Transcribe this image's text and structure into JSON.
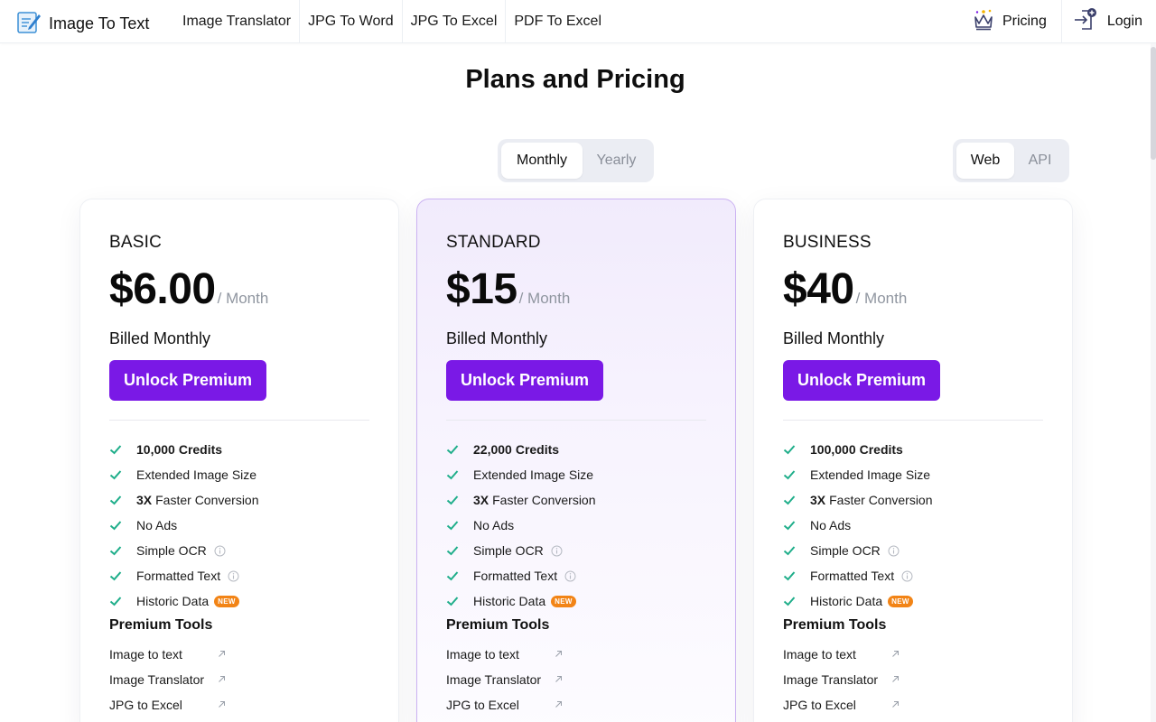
{
  "header": {
    "logo_text": "Image To Text",
    "nav": [
      {
        "label": "Image Translator"
      },
      {
        "label": "JPG To Word"
      },
      {
        "label": "JPG To Excel"
      },
      {
        "label": "PDF To Excel"
      }
    ],
    "pricing_label": "Pricing",
    "login_label": "Login"
  },
  "page_title": "Plans and Pricing",
  "billing_toggle": {
    "options": [
      "Monthly",
      "Yearly"
    ],
    "selected": "Monthly"
  },
  "channel_toggle": {
    "options": [
      "Web",
      "API"
    ],
    "selected": "Web"
  },
  "colors": {
    "accent": "#7a19e6",
    "check": "#1fae8a",
    "badge": "#f28416",
    "highlight_border": "#cbb2f2"
  },
  "plans": [
    {
      "name": "BASIC",
      "price": "$6.00",
      "per": "/ Month",
      "billed": "Billed Monthly",
      "cta": "Unlock Premium",
      "features": {
        "credits": {
          "value": "10,000",
          "label": "Credits"
        },
        "image_size": "Extended Image Size",
        "faster": {
          "value": "3X",
          "label": "Faster Conversion"
        },
        "no_ads": "No Ads",
        "simple_ocr": "Simple OCR",
        "formatted_text": "Formatted Text",
        "historic_data": "Historic Data",
        "new_badge": "NEW"
      },
      "tools_title": "Premium Tools",
      "tools": [
        "Image to text",
        "Image Translator",
        "JPG to Excel"
      ]
    },
    {
      "name": "STANDARD",
      "price": "$15",
      "per": "/ Month",
      "billed": "Billed Monthly",
      "cta": "Unlock Premium",
      "features": {
        "credits": {
          "value": "22,000",
          "label": "Credits"
        },
        "image_size": "Extended Image Size",
        "faster": {
          "value": "3X",
          "label": "Faster Conversion"
        },
        "no_ads": "No Ads",
        "simple_ocr": "Simple OCR",
        "formatted_text": "Formatted Text",
        "historic_data": "Historic Data",
        "new_badge": "NEW"
      },
      "tools_title": "Premium Tools",
      "tools": [
        "Image to text",
        "Image Translator",
        "JPG to Excel"
      ]
    },
    {
      "name": "BUSINESS",
      "price": "$40",
      "per": "/ Month",
      "billed": "Billed Monthly",
      "cta": "Unlock Premium",
      "features": {
        "credits": {
          "value": "100,000",
          "label": "Credits"
        },
        "image_size": "Extended Image Size",
        "faster": {
          "value": "3X",
          "label": "Faster Conversion"
        },
        "no_ads": "No Ads",
        "simple_ocr": "Simple OCR",
        "formatted_text": "Formatted Text",
        "historic_data": "Historic Data",
        "new_badge": "NEW"
      },
      "tools_title": "Premium Tools",
      "tools": [
        "Image to text",
        "Image Translator",
        "JPG to Excel"
      ]
    }
  ]
}
